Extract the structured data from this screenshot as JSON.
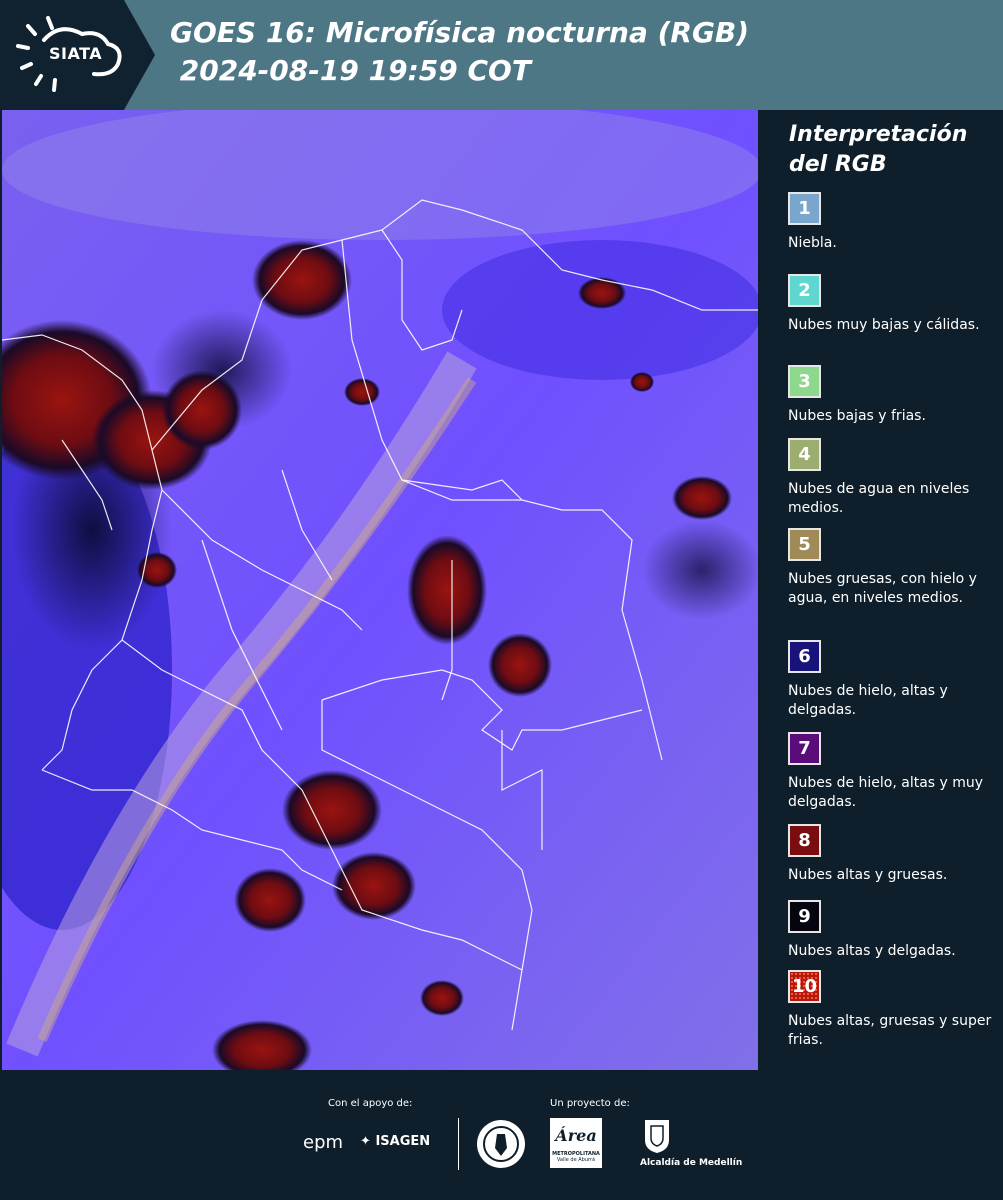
{
  "header": {
    "logo_text": "SIATA",
    "title_line1": "GOES 16: Microfísica nocturna (RGB)",
    "title_line2": " 2024-08-19 19:59 COT"
  },
  "legend": {
    "title_line1": "Interpretación",
    "title_line2": "del RGB",
    "items": [
      {
        "number": "1",
        "label": "Niebla.",
        "color": "#7aa6cd"
      },
      {
        "number": "2",
        "label": "Nubes muy bajas y cálidas.",
        "color": "#5fd6d0"
      },
      {
        "number": "3",
        "label": "Nubes bajas y frias.",
        "color": "#8ed88e"
      },
      {
        "number": "4",
        "label": "Nubes de agua en niveles medios.",
        "color": "#9cad70"
      },
      {
        "number": "5",
        "label": "Nubes gruesas, con hielo y agua, en niveles medios.",
        "color": "#a08a58"
      },
      {
        "number": "6",
        "label": "Nubes de hielo, altas y delgadas.",
        "color": "#17137a"
      },
      {
        "number": "7",
        "label": "Nubes de hielo, altas y muy delgadas.",
        "color": "#5a0d7a"
      },
      {
        "number": "8",
        "label": "Nubes altas y gruesas.",
        "color": "#7a0d10"
      },
      {
        "number": "9",
        "label": "Nubes altas y delgadas.",
        "color": "#050510"
      },
      {
        "number": "10",
        "label": "Nubes altas, gruesas y super frias.",
        "color": "#b21a10"
      }
    ]
  },
  "footer": {
    "support_label": "Con el apoyo de:",
    "project_label": "Un proyecto de:",
    "sponsor_epm": "epm",
    "sponsor_isagen": "ISAGEN",
    "sponsor_metro": "Área",
    "sponsor_metro_sub": "METROPOLITANA",
    "sponsor_metro_sub2": "Valle de Aburrá",
    "sponsor_alcaldia": "Alcaldía de Medellín"
  }
}
